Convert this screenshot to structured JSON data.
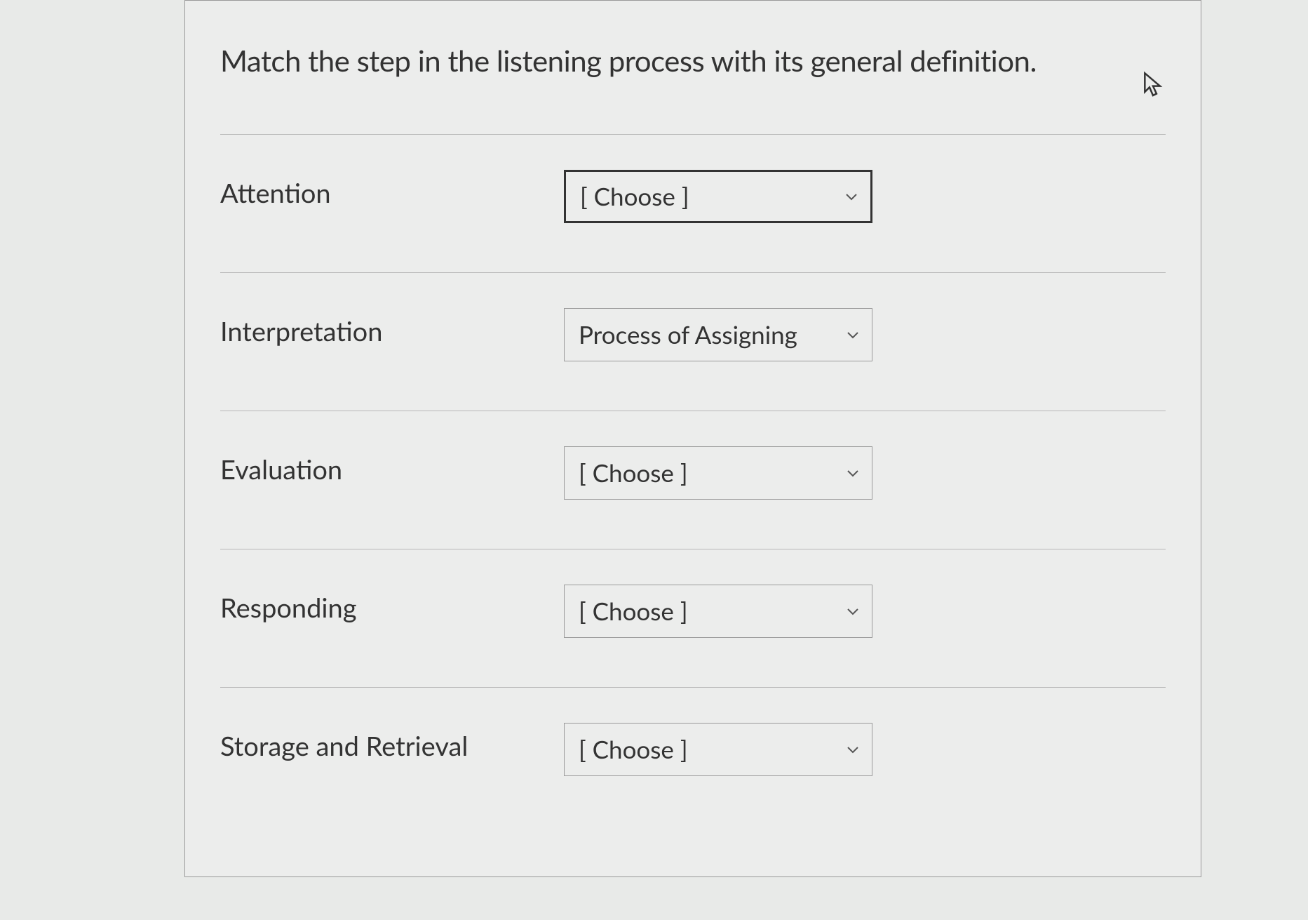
{
  "question": {
    "prompt": "Match the step in the listening process with its general definition."
  },
  "placeholder": "[ Choose ]",
  "rows": [
    {
      "label": "Attention",
      "selected": "[ Choose ]",
      "focused": true
    },
    {
      "label": "Interpretation",
      "selected": "Process of Assigning",
      "focused": false
    },
    {
      "label": "Evaluation",
      "selected": "[ Choose ]",
      "focused": false
    },
    {
      "label": "Responding",
      "selected": "[ Choose ]",
      "focused": false
    },
    {
      "label": "Storage and Retrieval",
      "selected": "[ Choose ]",
      "focused": false
    }
  ]
}
